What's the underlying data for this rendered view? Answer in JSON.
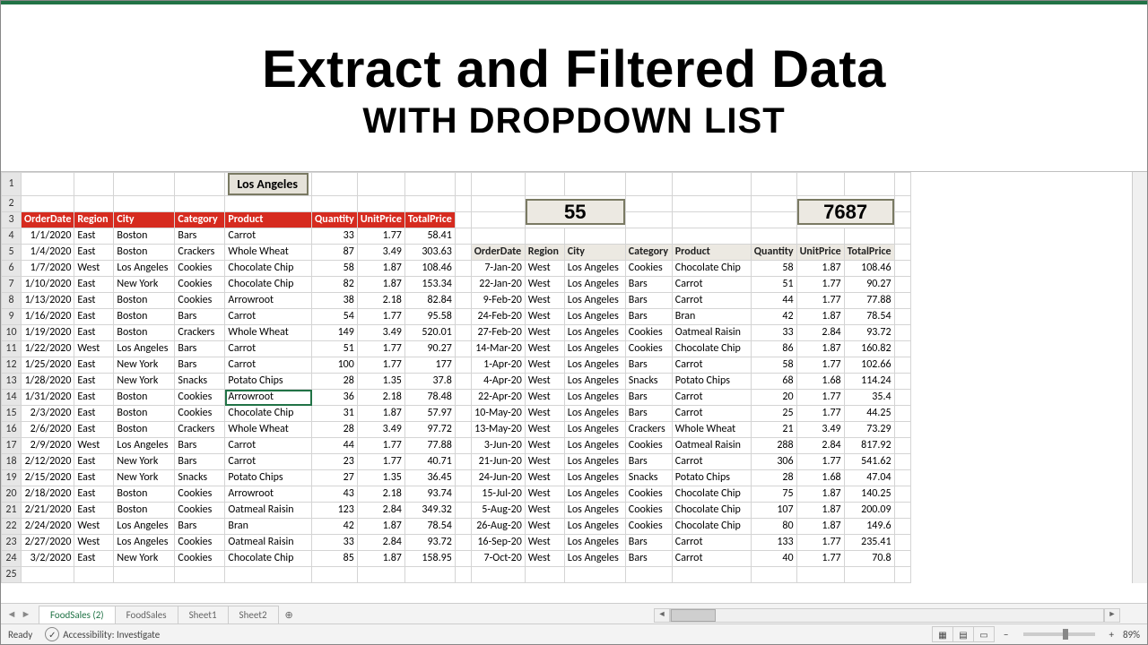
{
  "title_main": "Extract and Filtered Data",
  "title_sub": "WITH DROPDOWN LIST",
  "dropdown_value": "Los Angeles",
  "summary_count": "55",
  "summary_total": "7687",
  "left": {
    "headers": [
      "OrderDate",
      "Region",
      "City",
      "Category",
      "Product",
      "Quantity",
      "UnitPrice",
      "TotalPrice"
    ],
    "rows": [
      [
        "1/1/2020",
        "East",
        "Boston",
        "Bars",
        "Carrot",
        "33",
        "1.77",
        "58.41"
      ],
      [
        "1/4/2020",
        "East",
        "Boston",
        "Crackers",
        "Whole Wheat",
        "87",
        "3.49",
        "303.63"
      ],
      [
        "1/7/2020",
        "West",
        "Los Angeles",
        "Cookies",
        "Chocolate Chip",
        "58",
        "1.87",
        "108.46"
      ],
      [
        "1/10/2020",
        "East",
        "New York",
        "Cookies",
        "Chocolate Chip",
        "82",
        "1.87",
        "153.34"
      ],
      [
        "1/13/2020",
        "East",
        "Boston",
        "Cookies",
        "Arrowroot",
        "38",
        "2.18",
        "82.84"
      ],
      [
        "1/16/2020",
        "East",
        "Boston",
        "Bars",
        "Carrot",
        "54",
        "1.77",
        "95.58"
      ],
      [
        "1/19/2020",
        "East",
        "Boston",
        "Crackers",
        "Whole Wheat",
        "149",
        "3.49",
        "520.01"
      ],
      [
        "1/22/2020",
        "West",
        "Los Angeles",
        "Bars",
        "Carrot",
        "51",
        "1.77",
        "90.27"
      ],
      [
        "1/25/2020",
        "East",
        "New York",
        "Bars",
        "Carrot",
        "100",
        "1.77",
        "177"
      ],
      [
        "1/28/2020",
        "East",
        "New York",
        "Snacks",
        "Potato Chips",
        "28",
        "1.35",
        "37.8"
      ],
      [
        "1/31/2020",
        "East",
        "Boston",
        "Cookies",
        "Arrowroot",
        "36",
        "2.18",
        "78.48"
      ],
      [
        "2/3/2020",
        "East",
        "Boston",
        "Cookies",
        "Chocolate Chip",
        "31",
        "1.87",
        "57.97"
      ],
      [
        "2/6/2020",
        "East",
        "Boston",
        "Crackers",
        "Whole Wheat",
        "28",
        "3.49",
        "97.72"
      ],
      [
        "2/9/2020",
        "West",
        "Los Angeles",
        "Bars",
        "Carrot",
        "44",
        "1.77",
        "77.88"
      ],
      [
        "2/12/2020",
        "East",
        "New York",
        "Bars",
        "Carrot",
        "23",
        "1.77",
        "40.71"
      ],
      [
        "2/15/2020",
        "East",
        "New York",
        "Snacks",
        "Potato Chips",
        "27",
        "1.35",
        "36.45"
      ],
      [
        "2/18/2020",
        "East",
        "Boston",
        "Cookies",
        "Arrowroot",
        "43",
        "2.18",
        "93.74"
      ],
      [
        "2/21/2020",
        "East",
        "Boston",
        "Cookies",
        "Oatmeal Raisin",
        "123",
        "2.84",
        "349.32"
      ],
      [
        "2/24/2020",
        "West",
        "Los Angeles",
        "Bars",
        "Bran",
        "42",
        "1.87",
        "78.54"
      ],
      [
        "2/27/2020",
        "West",
        "Los Angeles",
        "Cookies",
        "Oatmeal Raisin",
        "33",
        "2.84",
        "93.72"
      ],
      [
        "3/2/2020",
        "East",
        "New York",
        "Cookies",
        "Chocolate Chip",
        "85",
        "1.87",
        "158.95"
      ]
    ]
  },
  "right": {
    "headers": [
      "OrderDate",
      "Region",
      "City",
      "Category",
      "Product",
      "Quantity",
      "UnitPrice",
      "TotalPrice"
    ],
    "rows": [
      [
        "7-Jan-20",
        "West",
        "Los Angeles",
        "Cookies",
        "Chocolate Chip",
        "58",
        "1.87",
        "108.46"
      ],
      [
        "22-Jan-20",
        "West",
        "Los Angeles",
        "Bars",
        "Carrot",
        "51",
        "1.77",
        "90.27"
      ],
      [
        "9-Feb-20",
        "West",
        "Los Angeles",
        "Bars",
        "Carrot",
        "44",
        "1.77",
        "77.88"
      ],
      [
        "24-Feb-20",
        "West",
        "Los Angeles",
        "Bars",
        "Bran",
        "42",
        "1.87",
        "78.54"
      ],
      [
        "27-Feb-20",
        "West",
        "Los Angeles",
        "Cookies",
        "Oatmeal Raisin",
        "33",
        "2.84",
        "93.72"
      ],
      [
        "14-Mar-20",
        "West",
        "Los Angeles",
        "Cookies",
        "Chocolate Chip",
        "86",
        "1.87",
        "160.82"
      ],
      [
        "1-Apr-20",
        "West",
        "Los Angeles",
        "Bars",
        "Carrot",
        "58",
        "1.77",
        "102.66"
      ],
      [
        "4-Apr-20",
        "West",
        "Los Angeles",
        "Snacks",
        "Potato Chips",
        "68",
        "1.68",
        "114.24"
      ],
      [
        "22-Apr-20",
        "West",
        "Los Angeles",
        "Bars",
        "Carrot",
        "20",
        "1.77",
        "35.4"
      ],
      [
        "10-May-20",
        "West",
        "Los Angeles",
        "Bars",
        "Carrot",
        "25",
        "1.77",
        "44.25"
      ],
      [
        "13-May-20",
        "West",
        "Los Angeles",
        "Crackers",
        "Whole Wheat",
        "21",
        "3.49",
        "73.29"
      ],
      [
        "3-Jun-20",
        "West",
        "Los Angeles",
        "Cookies",
        "Oatmeal Raisin",
        "288",
        "2.84",
        "817.92"
      ],
      [
        "21-Jun-20",
        "West",
        "Los Angeles",
        "Bars",
        "Carrot",
        "306",
        "1.77",
        "541.62"
      ],
      [
        "24-Jun-20",
        "West",
        "Los Angeles",
        "Snacks",
        "Potato Chips",
        "28",
        "1.68",
        "47.04"
      ],
      [
        "15-Jul-20",
        "West",
        "Los Angeles",
        "Cookies",
        "Chocolate Chip",
        "75",
        "1.87",
        "140.25"
      ],
      [
        "5-Aug-20",
        "West",
        "Los Angeles",
        "Cookies",
        "Chocolate Chip",
        "107",
        "1.87",
        "200.09"
      ],
      [
        "26-Aug-20",
        "West",
        "Los Angeles",
        "Cookies",
        "Chocolate Chip",
        "80",
        "1.87",
        "149.6"
      ],
      [
        "16-Sep-20",
        "West",
        "Los Angeles",
        "Bars",
        "Carrot",
        "133",
        "1.77",
        "235.41"
      ],
      [
        "7-Oct-20",
        "West",
        "Los Angeles",
        "Bars",
        "Carrot",
        "40",
        "1.77",
        "70.8"
      ]
    ]
  },
  "tabs": [
    "FoodSales (2)",
    "FoodSales",
    "Sheet1",
    "Sheet2"
  ],
  "add_tab": "⊕",
  "status": {
    "ready": "Ready",
    "access": "Accessibility: Investigate",
    "zoom": "89%"
  },
  "row_start": 1,
  "selected_row": 14,
  "chart_data": {}
}
